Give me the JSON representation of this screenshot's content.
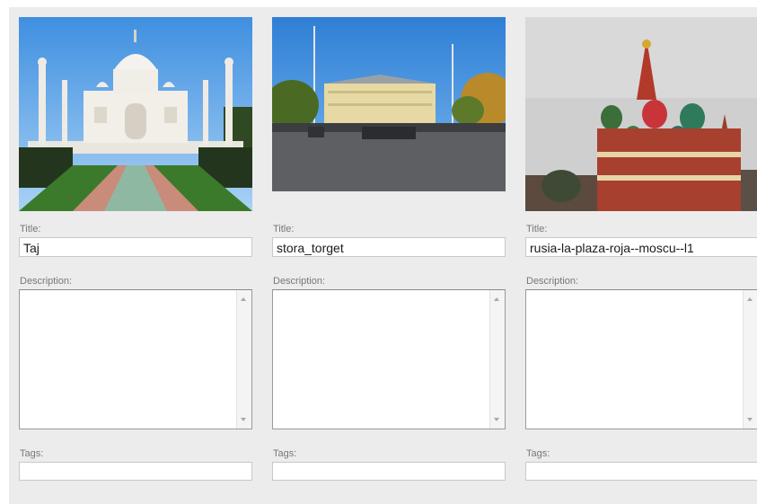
{
  "labels": {
    "title": "Title:",
    "description": "Description:",
    "tags": "Tags:"
  },
  "items": [
    {
      "title_value": "Taj",
      "description_value": "",
      "tags_value": "",
      "photo_icon": "taj-mahal-photo"
    },
    {
      "title_value": "stora_torget",
      "description_value": "",
      "tags_value": "",
      "photo_icon": "town-square-photo"
    },
    {
      "title_value": "rusia-la-plaza-roja--moscu--l1",
      "description_value": "",
      "tags_value": "",
      "photo_icon": "st-basils-cathedral-photo"
    }
  ],
  "colors": {
    "panel_background": "#ececec",
    "label_text": "#777777",
    "input_border": "#c8c8c8"
  }
}
